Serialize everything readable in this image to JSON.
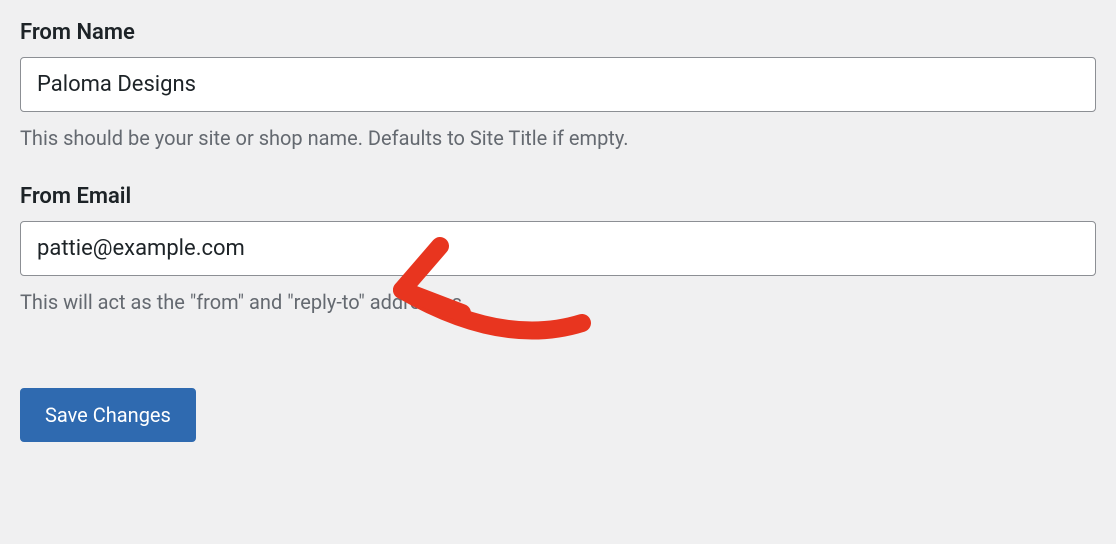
{
  "form": {
    "from_name": {
      "label": "From Name",
      "value": "Paloma Designs",
      "help": "This should be your site or shop name. Defaults to Site Title if empty."
    },
    "from_email": {
      "label": "From Email",
      "value": "pattie@example.com",
      "help": "This will act as the \"from\" and \"reply-to\" addresses."
    },
    "save_label": "Save Changes"
  }
}
